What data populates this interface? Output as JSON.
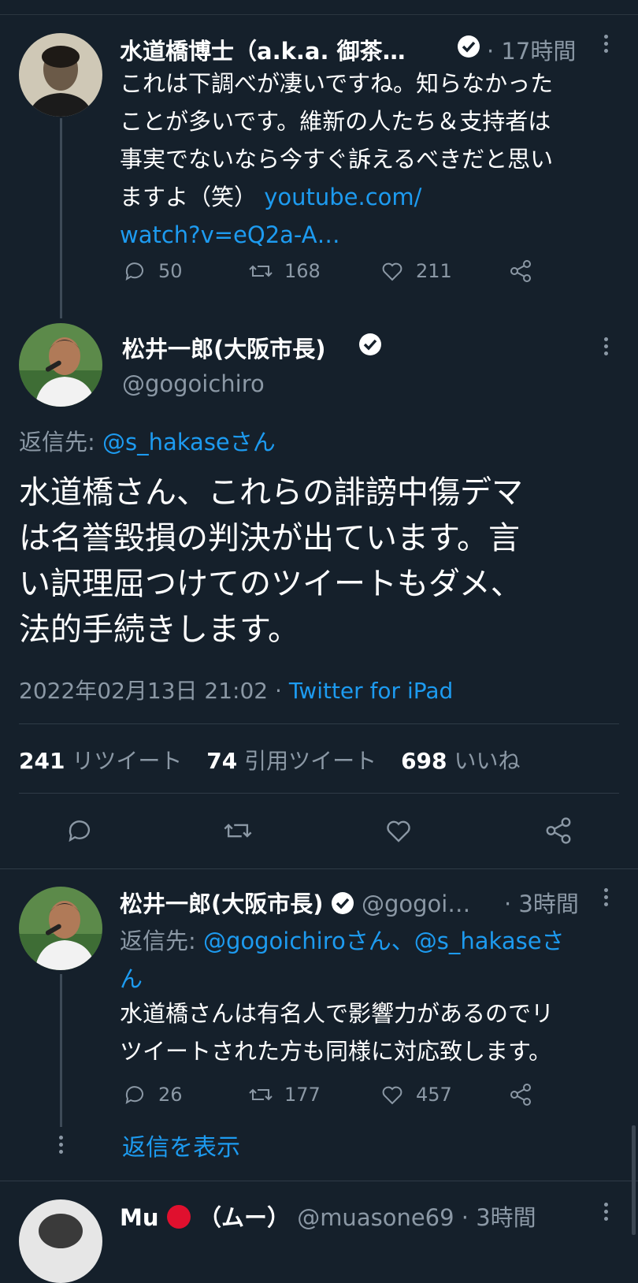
{
  "tweet1": {
    "name": "水道橋博士（a.k.a. 御茶…",
    "time": "· 17時間",
    "text_lines": [
      "これは下調べが凄いですね。知らなかった",
      "ことが多いです。維新の人たち＆支持者は",
      "事実でないなら今すぐ訴えるべきだと思い"
    ],
    "text_last": "ますよ（笑）",
    "link1": "youtube.com/",
    "link2": "watch?v=eQ2a-A…",
    "replies": "50",
    "retweets": "168",
    "likes": "211"
  },
  "main": {
    "name": "松井一郎(大阪市長)",
    "handle": "@gogoichiro",
    "reply_to_label": "返信先:",
    "reply_to_user": "@s_hakaseさん",
    "text_lines": [
      "水道橋さん、これらの誹謗中傷デマ",
      "は名誉毀損の判決が出ています。言",
      "い訳理屈つけてのツイートもダメ、",
      "法的手続きします。"
    ],
    "datetime": "2022年02月13日 21:02 ·",
    "source": "Twitter for iPad",
    "retweets_count": "241",
    "retweets_label": "リツイート",
    "quotes_count": "74",
    "quotes_label": "引用ツイート",
    "likes_count": "698",
    "likes_label": "いいね"
  },
  "reply1": {
    "name": "松井一郎(大阪市長)",
    "handle": "@gogoi…",
    "time": "· 3時間",
    "reply_to_label": "返信先:",
    "reply_to_users": "@gogoichiroさん、@s_hakaseさ",
    "reply_to_wrap": "ん",
    "text_lines": [
      "水道橋さんは有名人で影響力があるのでリ",
      "ツイートされた方も同様に対応致します。"
    ],
    "replies": "26",
    "retweets": "177",
    "likes": "457",
    "show_replies": "返信を表示"
  },
  "reply2": {
    "name": "Mu",
    "name_suffix": "（ムー）",
    "handle": "@muasone69",
    "time": "· 3時間"
  },
  "colors": {
    "background": "#15202b",
    "accent": "#1d9bf0",
    "muted": "#8b98a5",
    "red_circle": "#e0102e"
  }
}
